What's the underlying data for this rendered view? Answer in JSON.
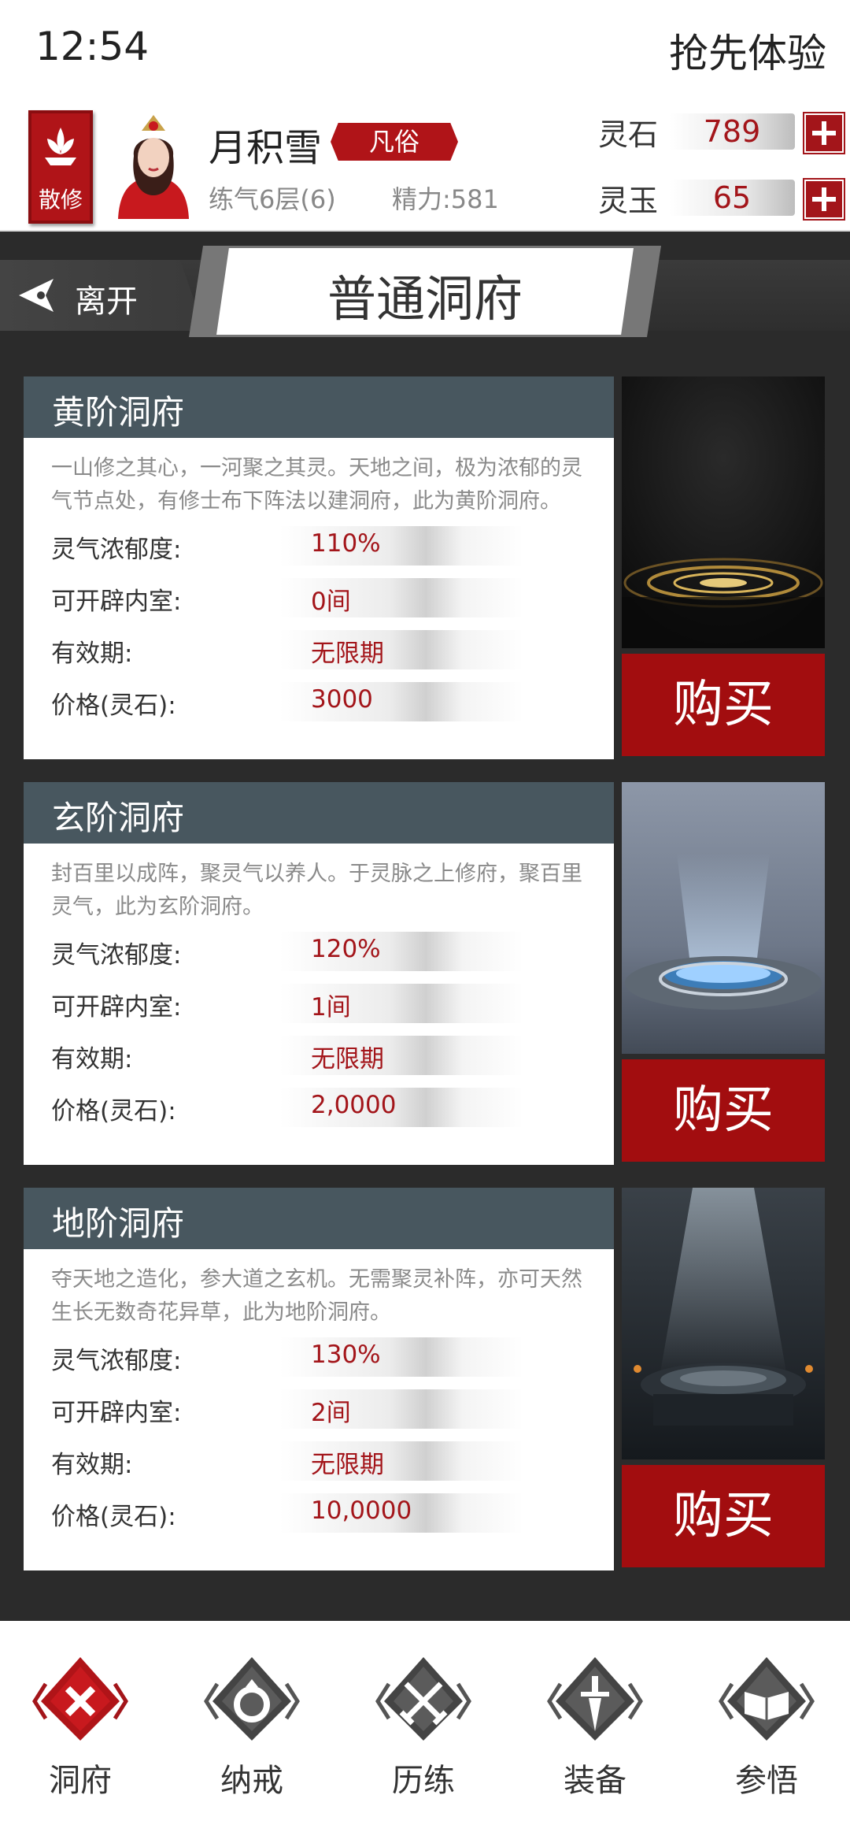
{
  "status_bar": {
    "time": "12:54",
    "promo": "抢先体验"
  },
  "player": {
    "sect_badge": "散修",
    "name": "月积雪",
    "rank": "凡俗",
    "realm": "练气6层(6)",
    "energy": "精力:581"
  },
  "currencies": [
    {
      "label": "灵石",
      "value": "789"
    },
    {
      "label": "灵玉",
      "value": "65"
    }
  ],
  "banner": {
    "back_label": "离开",
    "title": "普通洞府"
  },
  "caves": [
    {
      "title": "黄阶洞府",
      "desc": "一山修之其心，一河聚之其灵。天地之间，极为浓郁的灵气节点处，有修士布下阵法以建洞府，此为黄阶洞府。",
      "rows": [
        {
          "label": "灵气浓郁度:",
          "value": "110%"
        },
        {
          "label": "可开辟内室:",
          "value": "0间"
        },
        {
          "label": "有效期:",
          "value": "无限期"
        },
        {
          "label": "价格(灵石):",
          "value": "3000"
        }
      ],
      "buy": "购买"
    },
    {
      "title": "玄阶洞府",
      "desc": "封百里以成阵，聚灵气以养人。于灵脉之上修府，聚百里灵气，此为玄阶洞府。",
      "rows": [
        {
          "label": "灵气浓郁度:",
          "value": "120%"
        },
        {
          "label": "可开辟内室:",
          "value": "1间"
        },
        {
          "label": "有效期:",
          "value": "无限期"
        },
        {
          "label": "价格(灵石):",
          "value": "2,0000"
        }
      ],
      "buy": "购买"
    },
    {
      "title": "地阶洞府",
      "desc": "夺天地之造化，参大道之玄机。无需聚灵补阵，亦可天然生长无数奇花异草，此为地阶洞府。",
      "rows": [
        {
          "label": "灵气浓郁度:",
          "value": "130%"
        },
        {
          "label": "可开辟内室:",
          "value": "2间"
        },
        {
          "label": "有效期:",
          "value": "无限期"
        },
        {
          "label": "价格(灵石):",
          "value": "10,0000"
        }
      ],
      "buy": "购买"
    }
  ],
  "nav": [
    {
      "label": "洞府",
      "icon": "cave-icon",
      "active": true
    },
    {
      "label": "纳戒",
      "icon": "ring-icon",
      "active": false
    },
    {
      "label": "历练",
      "icon": "crossed-swords-icon",
      "active": false
    },
    {
      "label": "装备",
      "icon": "sword-icon",
      "active": false
    },
    {
      "label": "参悟",
      "icon": "book-icon",
      "active": false
    }
  ],
  "colors": {
    "accent": "#a3151a",
    "card_header": "#48575f",
    "background": "#2b2b2b"
  }
}
